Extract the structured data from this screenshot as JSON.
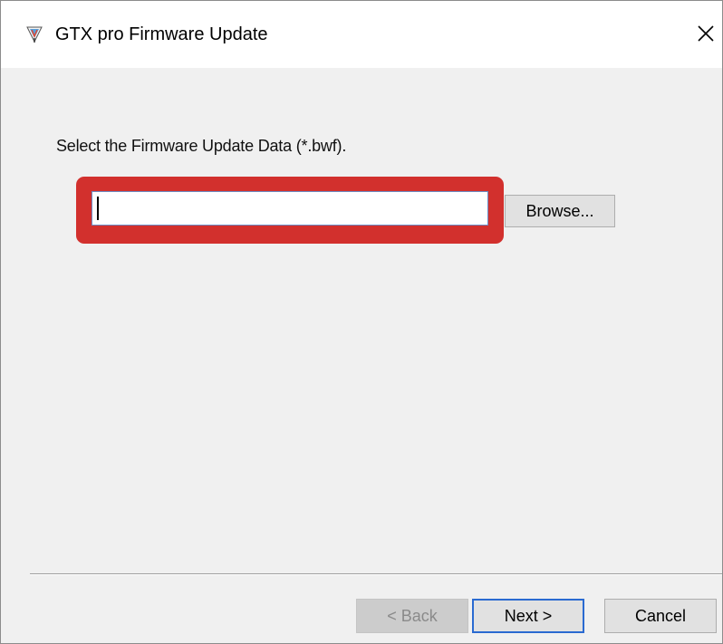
{
  "window": {
    "title": "GTX pro Firmware Update",
    "icon": "pen-app-icon",
    "close_glyph": "✕"
  },
  "main": {
    "prompt": "Select the Firmware Update Data (*.bwf).",
    "file_input": {
      "value": ""
    },
    "browse_label": "Browse...",
    "highlight_color": "#d2302d"
  },
  "footer": {
    "back_label": "< Back",
    "next_label": "Next >",
    "cancel_label": "Cancel"
  }
}
